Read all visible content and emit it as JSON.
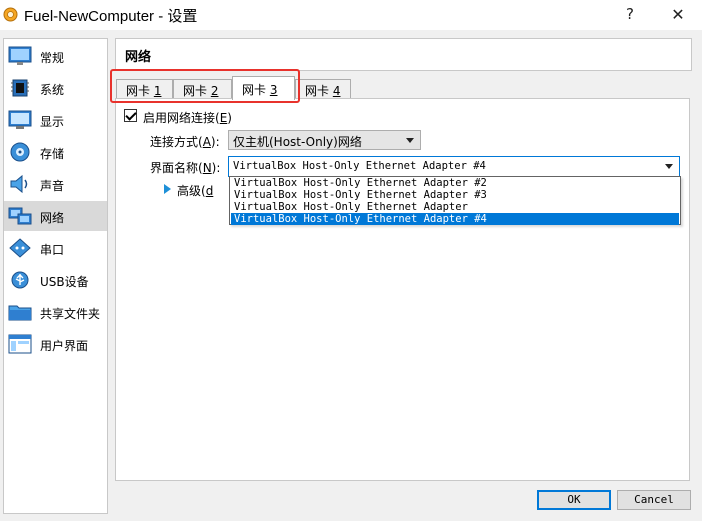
{
  "window": {
    "title": "Fuel-NewComputer - 设置",
    "help_glyph": "?",
    "close_glyph": "✕"
  },
  "sidebar": {
    "items": [
      {
        "label": "常规",
        "icon": "general-monitor-icon",
        "selected": false
      },
      {
        "label": "系统",
        "icon": "system-chip-icon",
        "selected": false
      },
      {
        "label": "显示",
        "icon": "display-monitor-icon",
        "selected": false
      },
      {
        "label": "存储",
        "icon": "storage-disk-icon",
        "selected": false
      },
      {
        "label": "声音",
        "icon": "audio-speaker-icon",
        "selected": false
      },
      {
        "label": "网络",
        "icon": "network-icon",
        "selected": true
      },
      {
        "label": "串口",
        "icon": "serial-port-icon",
        "selected": false
      },
      {
        "label": "USB设备",
        "icon": "usb-icon",
        "selected": false
      },
      {
        "label": "共享文件夹",
        "icon": "shared-folder-icon",
        "selected": false
      },
      {
        "label": "用户界面",
        "icon": "user-interface-icon",
        "selected": false
      }
    ]
  },
  "section": {
    "title": "网络"
  },
  "tabs": [
    {
      "prefix": "网卡 ",
      "key": "1",
      "active": false
    },
    {
      "prefix": "网卡 ",
      "key": "2",
      "active": false
    },
    {
      "prefix": "网卡 ",
      "key": "3",
      "active": true
    },
    {
      "prefix": "网卡 ",
      "key": "4",
      "active": false
    }
  ],
  "adapter": {
    "enable_label_prefix": "启用网络连接(",
    "enable_label_key": "E",
    "enable_label_suffix": ")",
    "enabled": true,
    "attached_label_prefix": "连接方式(",
    "attached_label_key": "A",
    "attached_label_suffix": "):",
    "attached_value": "仅主机(Host-Only)网络",
    "name_label_prefix": "界面名称(",
    "name_label_key": "N",
    "name_label_suffix": "):",
    "name_value": "VirtualBox Host-Only Ethernet Adapter #4",
    "advanced_label_prefix": "高级(",
    "advanced_label_key": "d",
    "name_options": [
      "VirtualBox Host-Only Ethernet Adapter #2",
      "VirtualBox Host-Only Ethernet Adapter #3",
      "VirtualBox Host-Only Ethernet Adapter",
      "VirtualBox Host-Only Ethernet Adapter #4"
    ],
    "selected_option_index": 3
  },
  "buttons": {
    "ok": "OK",
    "cancel": "Cancel"
  },
  "colors": {
    "accent": "#0078d7",
    "highlight_frame": "#e8322c",
    "selected_sidebar": "#d9d9d9"
  }
}
